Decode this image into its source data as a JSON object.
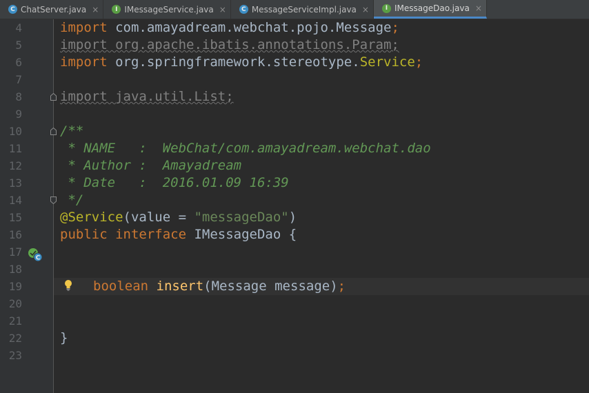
{
  "tabs": [
    {
      "label": "ChatServer.java",
      "icon": "class-icon",
      "icon_letter": "C",
      "active": false
    },
    {
      "label": "IMessageService.java",
      "icon": "interface-icon",
      "icon_letter": "I",
      "active": false
    },
    {
      "label": "MessageServiceImpl.java",
      "icon": "class-icon",
      "icon_letter": "C",
      "active": false
    },
    {
      "label": "IMessageDao.java",
      "icon": "interface-icon",
      "icon_letter": "I",
      "active": true
    }
  ],
  "close_glyph": "×",
  "line_numbers": [
    "4",
    "5",
    "6",
    "7",
    "8",
    "9",
    "10",
    "11",
    "12",
    "13",
    "14",
    "15",
    "16",
    "17",
    "18",
    "19",
    "20",
    "21",
    "22",
    "23"
  ],
  "code": {
    "l4": {
      "kw": "import",
      "rest": " com.amayadream.webchat.pojo.Message",
      "semi": ";"
    },
    "l5": {
      "text": "import org.apache.ibatis.annotations.Param;"
    },
    "l6": {
      "kw": "import",
      "mid": " org.springframework.stereotype.",
      "cls": "Service",
      "semi": ";"
    },
    "l8": {
      "text": "import java.util.List;"
    },
    "l10": {
      "doc": "/**"
    },
    "l11": {
      "prefix": " * NAME   :  ",
      "value": "WebChat/com.amayadream.webchat.dao"
    },
    "l12": {
      "prefix": " * Author :  ",
      "value": "Amayadream"
    },
    "l13": {
      "prefix": " * Date   :  ",
      "value": "2016.01.09 16:39"
    },
    "l14": {
      "doc": " */"
    },
    "l15": {
      "ann": "@Service",
      "open": "(value = ",
      "str": "\"messageDao\"",
      "close": ")"
    },
    "l16": {
      "kw1": "public",
      "kw2": "interface",
      "name": " IMessageDao {"
    },
    "l19": {
      "kw": "boolean",
      "fn": "insert",
      "args": "(Message message)",
      "semi": ";"
    },
    "l22": {
      "text": "}"
    }
  },
  "colors": {
    "keyword": "#cc7832",
    "string": "#6a8759",
    "annotation": "#bbb529",
    "doc": "#629755",
    "function": "#ffc66d",
    "text": "#a9b7c6",
    "accent": "#4a88c7"
  },
  "icons": {
    "gutter_marker": "implemented-interface-icon",
    "intention": "lightbulb-icon"
  }
}
